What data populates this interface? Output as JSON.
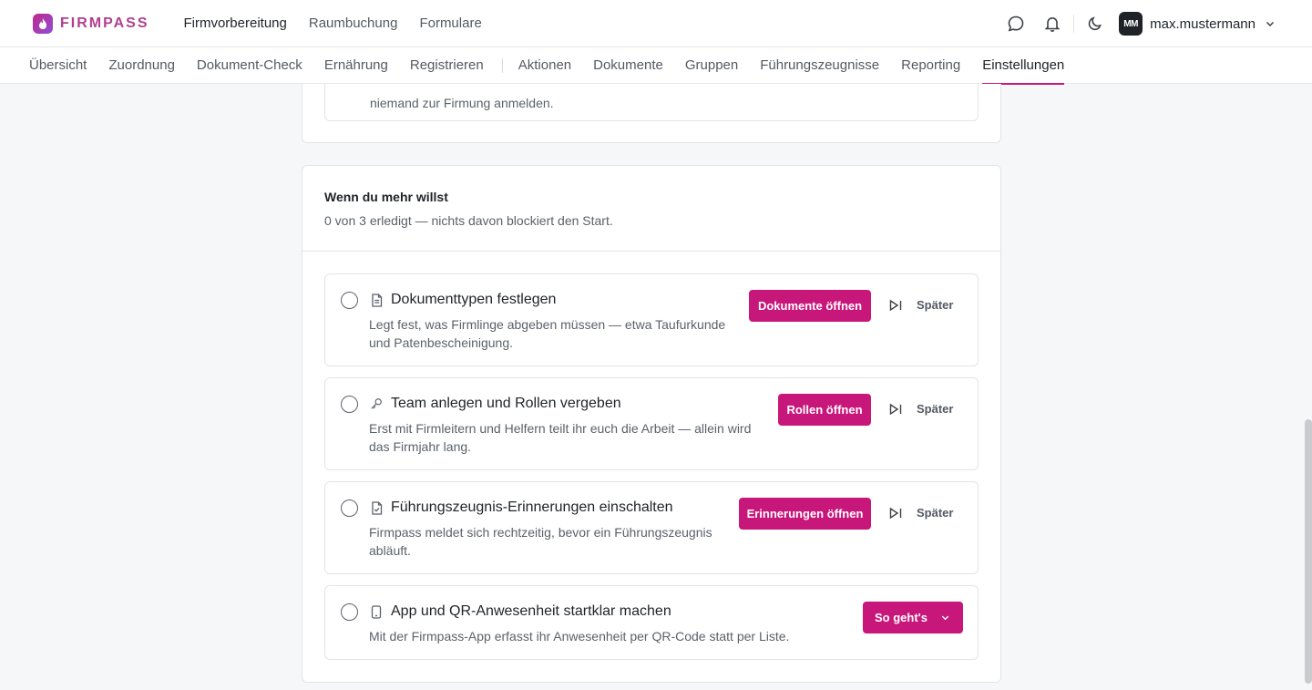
{
  "brand": {
    "name": "FIRMPASS",
    "accent": "#c8177a"
  },
  "main_nav": [
    "Firmvorbereitung",
    "Raumbuchung",
    "Formulare"
  ],
  "main_nav_active": "Firmvorbereitung",
  "user": {
    "initials": "MM",
    "name": "max.mustermann"
  },
  "icons": {
    "chat": "chat-icon",
    "bell": "bell-icon",
    "theme": "moon-icon",
    "menu": "chevron-down-icon"
  },
  "sub_nav": {
    "group1": [
      "Übersicht",
      "Zuordnung",
      "Dokument-Check",
      "Ernährung",
      "Registrieren"
    ],
    "group2": [
      "Aktionen",
      "Dokumente",
      "Gruppen",
      "Führungszeugnisse",
      "Reporting",
      "Einstellungen"
    ],
    "active": "Einstellungen"
  },
  "prev_card": {
    "text": "niemand zur Firmung anmelden."
  },
  "section": {
    "title": "Wenn du mehr willst",
    "subtitle": "0 von 3 erledigt — nichts davon blockiert den Start.",
    "later_label": "Später",
    "tasks": [
      {
        "icon": "document-icon",
        "title": "Dokumenttypen festlegen",
        "desc1": "Legt fest, was Firmlinge abgeben müssen — etwa Taufurkunde",
        "desc2": "und Patenbescheinigung.",
        "button": "Dokumente öffnen"
      },
      {
        "icon": "key-icon",
        "title": "Team anlegen und Rollen vergeben",
        "desc1": "Erst mit Firmleitern und Helfern teilt ihr euch die Arbeit — allein wird",
        "desc2": "das Firmjahr lang.",
        "button": "Rollen öffnen"
      },
      {
        "icon": "file-check-icon",
        "title": "Führungszeugnis-Erinnerungen einschalten",
        "desc1": "Firmpass meldet sich rechtzeitig, bevor ein Führungszeugnis",
        "desc2": "abläuft.",
        "button": "Erinnerungen öffnen"
      },
      {
        "icon": "smartphone-icon",
        "title": "App und QR-Anwesenheit startklar machen",
        "desc1": "Mit der Firmpass-App erfasst ihr Anwesenheit per QR-Code statt per Liste.",
        "button": "So geht's"
      }
    ]
  }
}
